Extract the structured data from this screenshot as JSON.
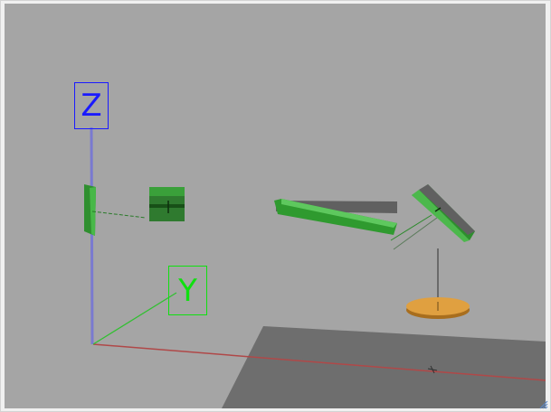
{
  "viewport": {
    "background": "#a5a5a5",
    "axes": {
      "z": {
        "label": "Z",
        "color": "#1a1aff"
      },
      "y": {
        "label": "Y",
        "color": "#10e010"
      },
      "x": {
        "color": "#b04040"
      }
    },
    "objects": [
      "left-link",
      "green-cube",
      "long-arm",
      "end-effector",
      "orange-disc",
      "ground-plane"
    ],
    "colors": {
      "link": "#2f9a2f",
      "gray_bar": "#5a5a5a",
      "disc": "#e0a040",
      "ground": "#6e6e6e"
    }
  },
  "controls": {
    "resize_grip_icon": "resize-grip-icon"
  }
}
